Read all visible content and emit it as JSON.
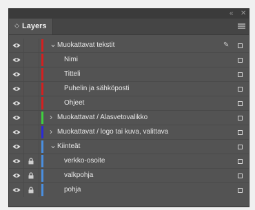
{
  "panel": {
    "title": "Layers",
    "collapse_icon": "double-chevron-left-icon",
    "close_icon": "close-icon",
    "menu_icon": "panel-menu-icon"
  },
  "layers": [
    {
      "label": "Muokattavat tekstit",
      "level": 0,
      "expander": "v",
      "color": "#d42020",
      "locked": false,
      "pen": true
    },
    {
      "label": "Nimi",
      "level": 1,
      "expander": "",
      "color": "#d42020",
      "locked": false,
      "pen": false
    },
    {
      "label": "Titteli",
      "level": 1,
      "expander": "",
      "color": "#d42020",
      "locked": false,
      "pen": false
    },
    {
      "label": "Puhelin ja sähköposti",
      "level": 1,
      "expander": "",
      "color": "#d42020",
      "locked": false,
      "pen": false
    },
    {
      "label": "Ohjeet",
      "level": 1,
      "expander": "",
      "color": "#d42020",
      "locked": false,
      "pen": false
    },
    {
      "label": "Muokattavat / Alasvetovalikko",
      "level": 0,
      "expander": ">",
      "color": "#3fd03f",
      "locked": false,
      "pen": false
    },
    {
      "label": "Muokattavat / logo tai kuva, valittava",
      "level": 0,
      "expander": ">",
      "color": "#2a2ad8",
      "locked": false,
      "pen": false
    },
    {
      "label": "Kiinteät",
      "level": 0,
      "expander": "v",
      "color": "#4a8fe0",
      "locked": false,
      "pen": false
    },
    {
      "label": "verkko-osoite",
      "level": 1,
      "expander": "",
      "color": "#4a8fe0",
      "locked": true,
      "pen": false
    },
    {
      "label": "valkpohja",
      "level": 1,
      "expander": "",
      "color": "#4a8fe0",
      "locked": true,
      "pen": false
    },
    {
      "label": "pohja",
      "level": 1,
      "expander": "",
      "color": "#4a8fe0",
      "locked": true,
      "pen": false
    }
  ]
}
